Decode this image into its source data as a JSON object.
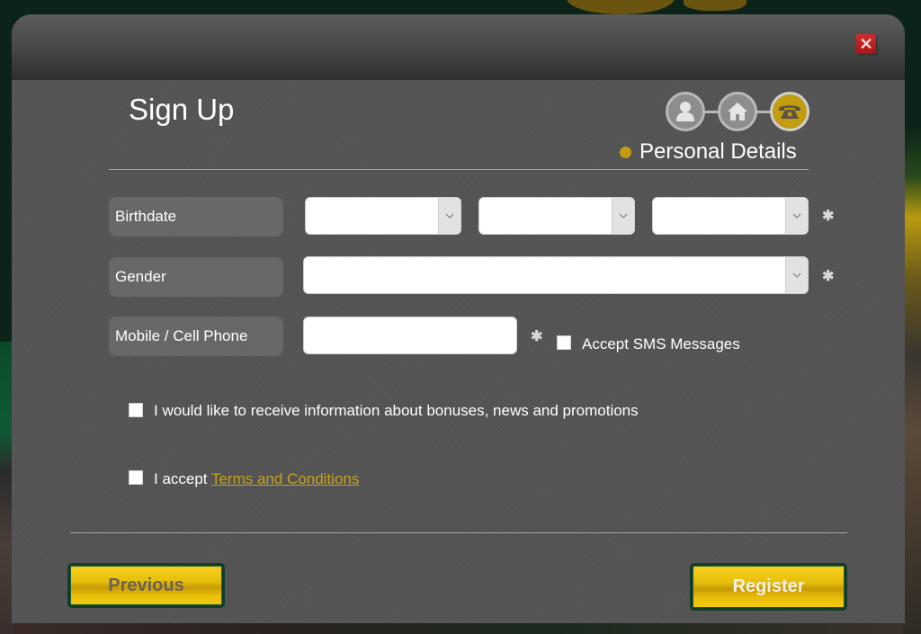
{
  "dialog": {
    "title": "Sign Up",
    "close_label": "✕",
    "steps": [
      {
        "name": "account",
        "icon": "user-icon",
        "active": false
      },
      {
        "name": "address",
        "icon": "home-icon",
        "active": false
      },
      {
        "name": "personal-details",
        "icon": "phone-icon",
        "active": true
      }
    ],
    "current_step_label": "Personal Details",
    "colors": {
      "accent": "#c49c12",
      "link": "#c6a11a",
      "close": "#c42020",
      "panel": "#545454"
    }
  },
  "form": {
    "birthdate": {
      "label": "Birthdate",
      "day_value": "",
      "month_value": "",
      "year_value": "",
      "required_mark": "✱"
    },
    "gender": {
      "label": "Gender",
      "value": "",
      "required_mark": "✱"
    },
    "mobile": {
      "label": "Mobile / Cell Phone",
      "value": "",
      "placeholder": "",
      "required_mark": "✱",
      "sms_label": "Accept SMS Messages",
      "sms_checked": false
    },
    "promotions": {
      "label": "I would like to receive information about bonuses, news and promotions",
      "checked": false
    },
    "terms": {
      "prefix": "I accept ",
      "link_text": "Terms and Conditions",
      "checked": false
    }
  },
  "footer": {
    "previous_label": "Previous",
    "register_label": "Register"
  }
}
